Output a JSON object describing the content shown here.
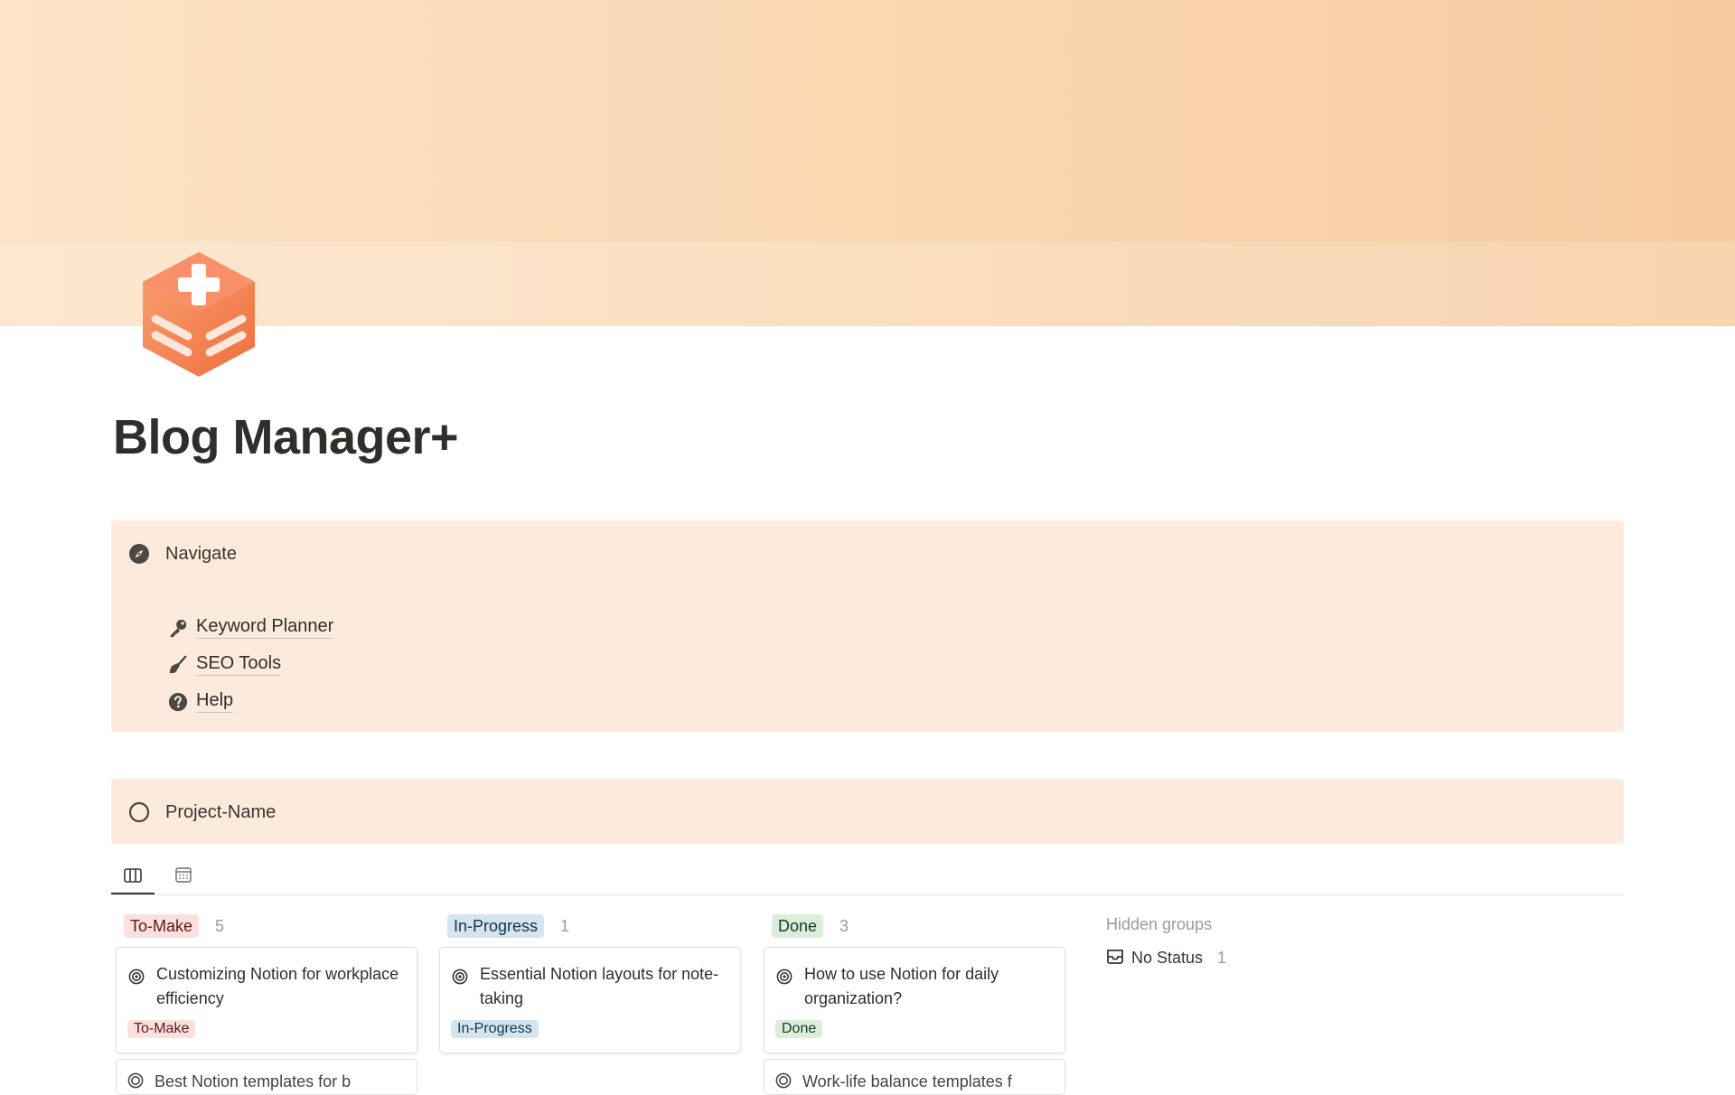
{
  "page": {
    "title": "Blog Manager+"
  },
  "navigate": {
    "heading": "Navigate",
    "links": [
      {
        "label": "Keyword Planner",
        "icon": "key-icon"
      },
      {
        "label": "SEO Tools",
        "icon": "broom-icon"
      },
      {
        "label": "Help",
        "icon": "help-icon"
      }
    ]
  },
  "project": {
    "heading": "Project-Name"
  },
  "views": [
    {
      "icon": "board-view-icon",
      "active": true
    },
    {
      "icon": "calendar-view-icon",
      "active": false
    }
  ],
  "board": {
    "columns": [
      {
        "name": "To-Make",
        "count": "5",
        "color": "#fbe0de",
        "text_color": "#5d1715",
        "cards": [
          {
            "title": "Customizing Notion for workplace efficiency",
            "status": "To-Make"
          },
          {
            "title": "Best Notion templates for b",
            "status": ""
          }
        ]
      },
      {
        "name": "In-Progress",
        "count": "1",
        "color": "#d3e5ef",
        "text_color": "#183347",
        "cards": [
          {
            "title": "Essential Notion layouts for note-taking",
            "status": "In-Progress"
          }
        ]
      },
      {
        "name": "Done",
        "count": "3",
        "color": "#dbeddb",
        "text_color": "#1c3829",
        "cards": [
          {
            "title": "How to use Notion for daily organization?",
            "status": "Done"
          },
          {
            "title": "Work-life balance templates f",
            "status": ""
          }
        ]
      }
    ],
    "hidden_groups": {
      "label": "Hidden groups",
      "items": [
        {
          "name": "No Status",
          "count": "1"
        }
      ]
    }
  },
  "colors": {
    "accent": "#f07b4a",
    "callout_bg": "#fcebdc"
  }
}
